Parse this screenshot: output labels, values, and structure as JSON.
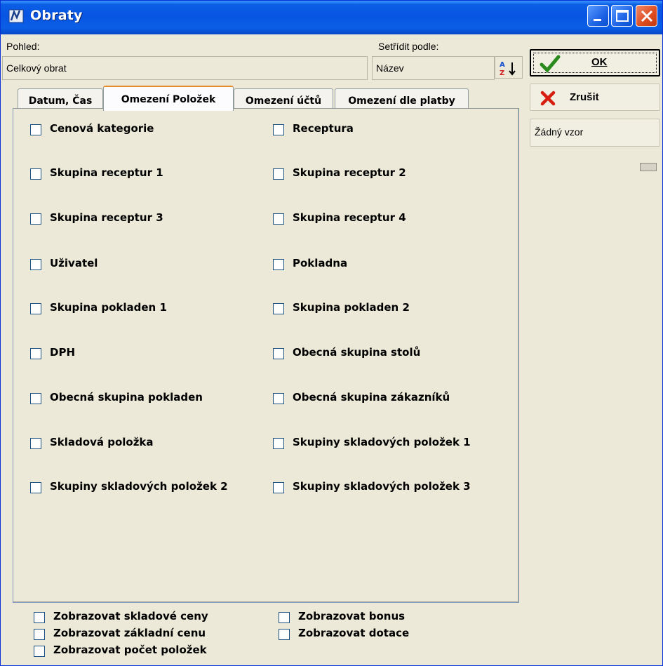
{
  "window": {
    "title": "Obraty"
  },
  "view": {
    "label": "Pohled:",
    "value": "Celkový obrat"
  },
  "sort": {
    "label": "Setřídit podle:",
    "value": "Název"
  },
  "buttons": {
    "ok": "OK",
    "cancel": "Zrušit",
    "template": "Žádný vzor"
  },
  "tabs": [
    {
      "label": "Datum, Čas",
      "active": false
    },
    {
      "label": "Omezení Položek",
      "active": true
    },
    {
      "label": "Omezení účtů",
      "active": false
    },
    {
      "label": "Omezení dle platby",
      "active": false
    }
  ],
  "filters": {
    "left": [
      "Cenová kategorie",
      "Skupina receptur 1",
      "Skupina receptur 3",
      "Uživatel",
      "Skupina pokladen 1",
      "DPH",
      "Obecná skupina pokladen",
      "Skladová položka",
      "Skupiny skladových položek 2"
    ],
    "right": [
      "Receptura",
      "Skupina receptur 2",
      "Skupina receptur 4",
      "Pokladna",
      "Skupina pokladen 2",
      "Obecná skupina stolů",
      "Obecná skupina zákazníků",
      "Skupiny skladových položek 1",
      "Skupiny skladových položek 3"
    ]
  },
  "options": {
    "left": [
      "Zobrazovat skladové ceny",
      "Zobrazovat základní cenu",
      "Zobrazovat počet položek"
    ],
    "right": [
      "Zobrazovat bonus",
      "Zobrazovat dotace"
    ]
  },
  "colors": {
    "titlebar": "#0a5ee4",
    "window_bg": "#ece9d8",
    "ok_check": "#2a8a1e",
    "cancel_x": "#d81e10"
  }
}
